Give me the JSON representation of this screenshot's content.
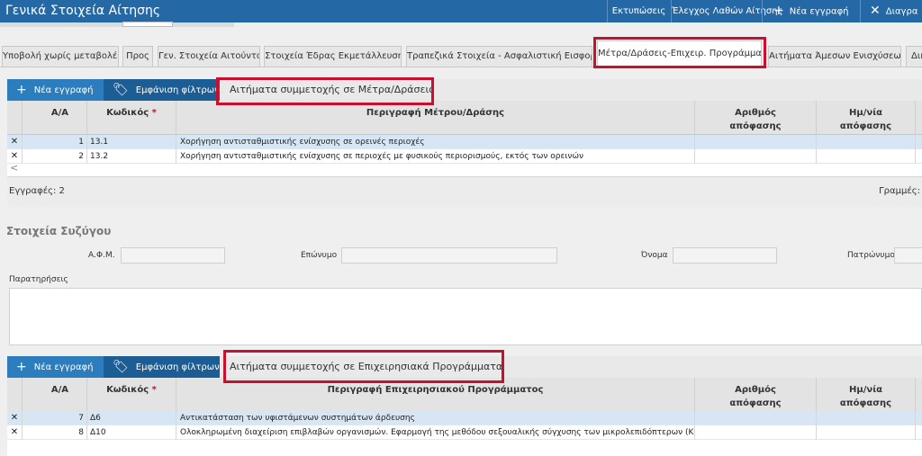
{
  "header": {
    "title": "Γενικά Στοιχεία Αίτησης",
    "buttons": {
      "print": "Εκτυπώσεις",
      "check_errors": "Έλεγχος Λαθών Αίτησης",
      "new_entry": "Νέα εγγραφή",
      "delete": "Διαγρα"
    },
    "icons": {
      "plus": "+",
      "close": "✕"
    }
  },
  "tabs": [
    {
      "label": "Υποβολή χωρίς μεταβολές"
    },
    {
      "label": "Προς"
    },
    {
      "label": "Γεν. Στοιχεία Αιτούντα"
    },
    {
      "label": "Στοιχεία Έδρας Εκμετάλλευσης"
    },
    {
      "label": "Τραπεζικά Στοιχεία - Ασφαλιστική Εισφορά"
    },
    {
      "label": "Μέτρα/Δράσεις-Επιχειρ. Προγράμματα",
      "active": true
    },
    {
      "label": "Αιτήματα Άμεσων Ενισχύσεων"
    },
    {
      "label": "Δικ"
    }
  ],
  "grid_common": {
    "new_entry": "Νέα εγγραφή",
    "show_filters": "Εμφάνιση φίλτρων",
    "col_aa": "Α/Α",
    "col_code": "Κωδικός",
    "required_mark": "*",
    "col_decision_no_1": "Αριθμός",
    "col_decision_no_2": "απόφασης",
    "col_decision_date_1": "Ημ/νία",
    "col_decision_date_2": "απόφασης",
    "delete_glyph": "✕",
    "plus_glyph": "+",
    "tag_glyph": "🏷",
    "scroll_left": "<"
  },
  "grid1": {
    "caption": "Αιτήματα συμμετοχής σε Μέτρα/Δράσεις",
    "col_desc": "Περιγραφή Μέτρου/Δράσης",
    "rows": [
      {
        "aa": "1",
        "code": "13.1",
        "desc": "Χορήγηση αντισταθμιστικής ενίσχυσης σε ορεινές περιοχές"
      },
      {
        "aa": "2",
        "code": "13.2",
        "desc": "Χορήγηση αντισταθμιστικής ενίσχυσης σε περιοχές με φυσικούς περιορισμούς, εκτός των ορεινών"
      }
    ],
    "footer_left": "Εγγραφές: 2",
    "footer_right": "Γραμμές:"
  },
  "spouse": {
    "title": "Στοιχεία Συζύγου",
    "afm": "Α.Φ.Μ.",
    "surname": "Επώνυμο",
    "name": "Όνομα",
    "patronymic": "Πατρώνυμο",
    "notes": "Παρατηρήσεις"
  },
  "grid2": {
    "caption": "Αιτήματα συμμετοχής σε Επιχειρησιακά Προγράμματα",
    "col_desc": "Περιγραφή Επιχειρησιακού Προγράμματος",
    "rows": [
      {
        "aa": "7",
        "code": "Δ6",
        "desc": "Αντικατάσταση των υφιστάμενων συστημάτων άρδευσης"
      },
      {
        "aa": "8",
        "code": "Δ10",
        "desc": "Ολοκληρωμένη διαχείριση επιβλαβών οργανισμών. Εφαρμογή της μεθόδου σεξουαλικής σύγχυσης των μικρολεπιδόπτερων (ΚΟΜΦΟΥΖΙΟ)"
      }
    ]
  }
}
